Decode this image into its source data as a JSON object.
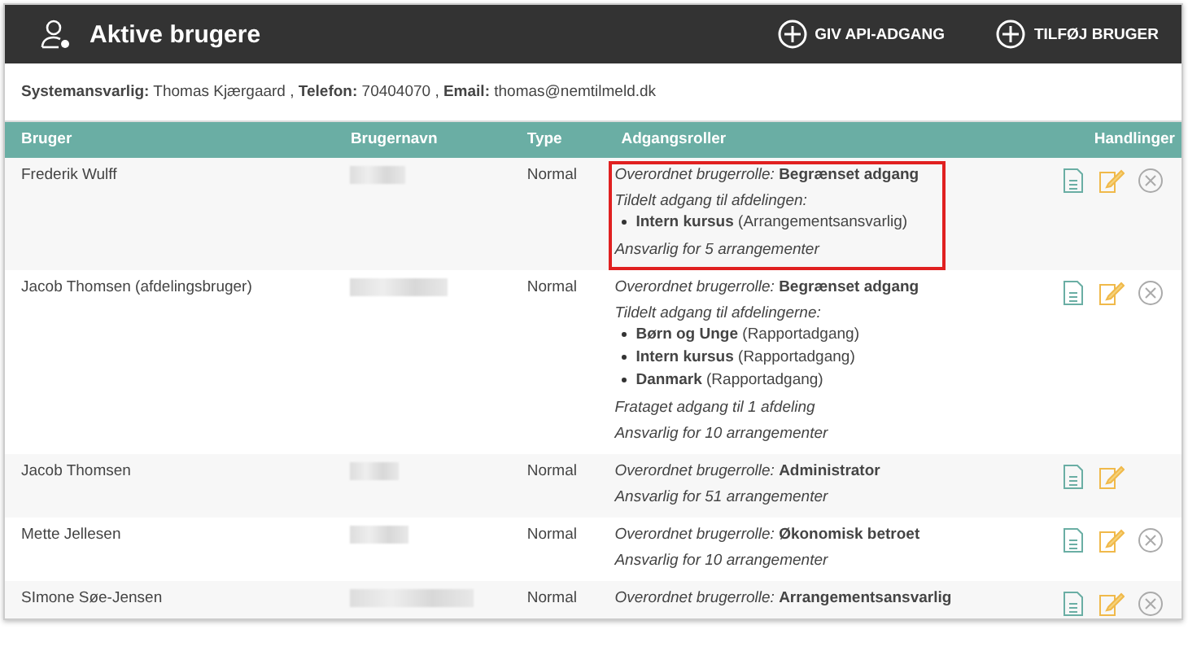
{
  "header": {
    "title": "Aktive brugere",
    "buttons": [
      "GIV API-ADGANG",
      "TILFØJ BRUGER"
    ]
  },
  "info": [
    {
      "label": "Systemansvarlig:",
      "value": "Thomas Kjærgaard ,"
    },
    {
      "label": "Telefon:",
      "value": "70404070 ,"
    },
    {
      "label": "Email:",
      "value": "thomas@nemtilmeld.dk"
    }
  ],
  "table": {
    "columns": [
      "Bruger",
      "Brugernavn",
      "Type",
      "Adgangsroller",
      "Handlinger"
    ],
    "rows": [
      {
        "user": "Frederik Wulff",
        "type": "Normal",
        "highlighted": true,
        "deletable": true,
        "roles": [
          {
            "kind": "role",
            "label": "Overordnet brugerrolle:",
            "value": "Begrænset adgang"
          },
          {
            "kind": "note",
            "text": "Tildelt adgang til afdelingen:"
          },
          {
            "kind": "dept",
            "name": "Intern kursus",
            "access": "(Arrangementsansvarlig)"
          },
          {
            "kind": "note",
            "text": "Ansvarlig for 5 arrangementer"
          }
        ]
      },
      {
        "user": "Jacob Thomsen (afdelingsbruger)",
        "type": "Normal",
        "highlighted": false,
        "deletable": true,
        "roles": [
          {
            "kind": "role",
            "label": "Overordnet brugerrolle:",
            "value": "Begrænset adgang"
          },
          {
            "kind": "note",
            "text": "Tildelt adgang til afdelingerne:"
          },
          {
            "kind": "dept",
            "name": "Børn og Unge",
            "access": "(Rapportadgang)"
          },
          {
            "kind": "dept",
            "name": "Intern kursus",
            "access": "(Rapportadgang)"
          },
          {
            "kind": "dept",
            "name": "Danmark",
            "access": "(Rapportadgang)"
          },
          {
            "kind": "note",
            "text": "Frataget adgang til 1 afdeling"
          },
          {
            "kind": "note",
            "text": "Ansvarlig for 10 arrangementer"
          }
        ]
      },
      {
        "user": "Jacob Thomsen",
        "type": "Normal",
        "highlighted": false,
        "deletable": false,
        "roles": [
          {
            "kind": "role",
            "label": "Overordnet brugerrolle:",
            "value": "Administrator"
          },
          {
            "kind": "note",
            "text": "Ansvarlig for 51 arrangementer"
          }
        ]
      },
      {
        "user": "Mette Jellesen",
        "type": "Normal",
        "highlighted": false,
        "deletable": true,
        "roles": [
          {
            "kind": "role",
            "label": "Overordnet brugerrolle:",
            "value": "Økonomisk betroet"
          },
          {
            "kind": "note",
            "text": "Ansvarlig for 10 arrangementer"
          }
        ]
      },
      {
        "user": "SImone Søe-Jensen",
        "type": "Normal",
        "highlighted": false,
        "deletable": true,
        "roles": [
          {
            "kind": "role",
            "label": "Overordnet brugerrolle:",
            "value": "Arrangementsansvarlig"
          }
        ]
      }
    ]
  }
}
